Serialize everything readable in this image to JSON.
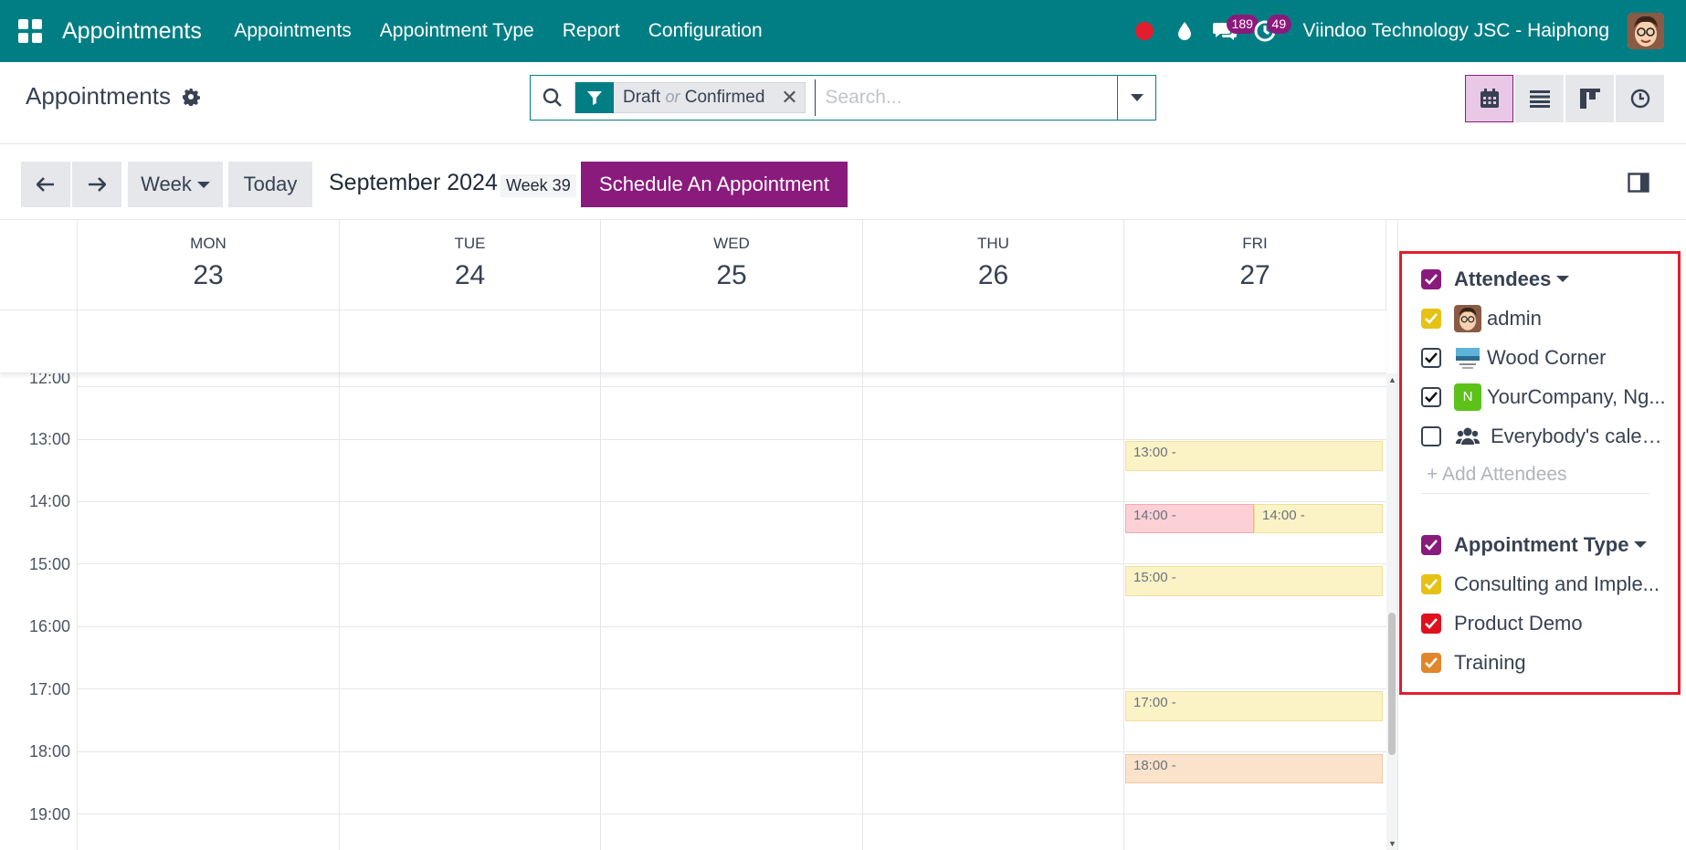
{
  "navbar": {
    "brand": "Appointments",
    "menu": [
      "Appointments",
      "Appointment Type",
      "Report",
      "Configuration"
    ],
    "messages_count": "189",
    "activities_count": "49",
    "company": "Viindoo Technology JSC - Haiphong"
  },
  "control": {
    "title": "Appointments",
    "facet_value1": "Draft",
    "facet_or": "or",
    "facet_value2": "Confirmed",
    "search_placeholder": "Search..."
  },
  "toolbar": {
    "scale_label": "Week",
    "today_label": "Today",
    "month": "September 2024",
    "week": "Week 39",
    "schedule_label": "Schedule An Appointment"
  },
  "days": [
    {
      "name": "MON",
      "num": "23"
    },
    {
      "name": "TUE",
      "num": "24"
    },
    {
      "name": "WED",
      "num": "25"
    },
    {
      "name": "THU",
      "num": "26"
    },
    {
      "name": "FRI",
      "num": "27"
    }
  ],
  "hours": [
    "12:00",
    "13:00",
    "14:00",
    "15:00",
    "16:00",
    "17:00",
    "18:00",
    "19:00"
  ],
  "events": [
    {
      "label": "13:00 -",
      "color": "yellow"
    },
    {
      "label": "14:00 -",
      "color": "pink"
    },
    {
      "label": "14:00 -",
      "color": "yellow"
    },
    {
      "label": "15:00 -",
      "color": "yellow"
    },
    {
      "label": "17:00 -",
      "color": "yellow"
    },
    {
      "label": "18:00 -",
      "color": "orange"
    }
  ],
  "filters": {
    "attendees": {
      "title": "Attendees",
      "items": [
        {
          "label": "admin",
          "checked": true,
          "color": "#e6c215"
        },
        {
          "label": "Wood Corner",
          "checked": true,
          "color": "#ffffff"
        },
        {
          "label": "YourCompany, Ng...",
          "checked": true,
          "color": "#ffffff",
          "avatar_letter": "N"
        },
        {
          "label": "Everybody's calen...",
          "checked": false,
          "color": "#ffffff"
        }
      ],
      "add_label": "+ Add Attendees"
    },
    "appointment_type": {
      "title": "Appointment Type",
      "items": [
        {
          "label": "Consulting and Imple...",
          "checked": true,
          "color": "#e6c215"
        },
        {
          "label": "Product Demo",
          "checked": true,
          "color": "#e0101e"
        },
        {
          "label": "Training",
          "checked": true,
          "color": "#e2862a"
        }
      ]
    }
  },
  "colors": {
    "navbar": "#017e84",
    "primary": "#8b1a7d",
    "highlight": "#e11d2e"
  }
}
